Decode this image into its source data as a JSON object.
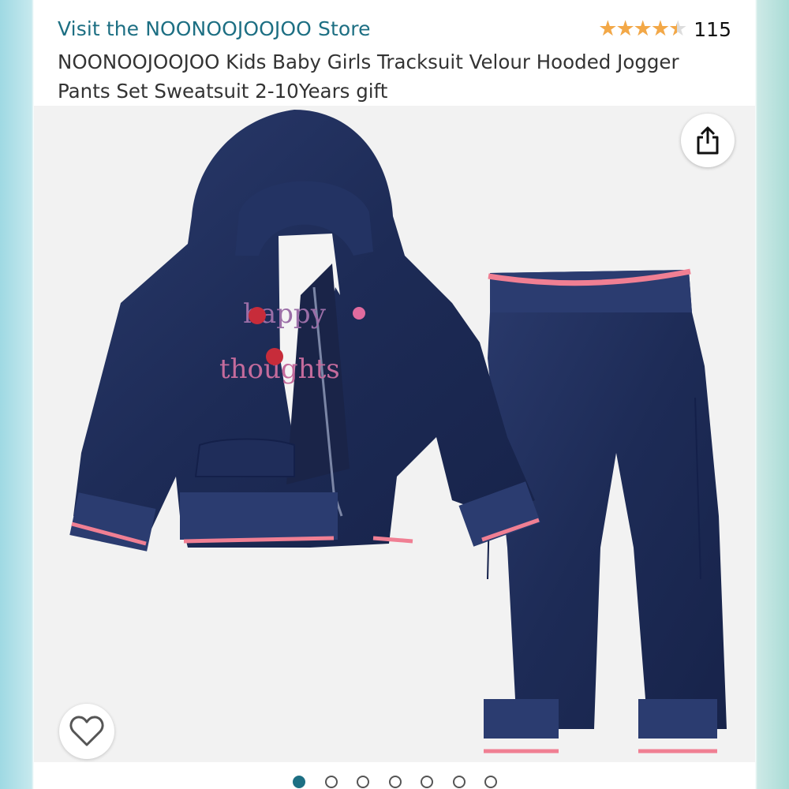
{
  "header": {
    "store_link": "Visit the NOONOOJOOJOO Store",
    "rating": {
      "value": 4.5,
      "max": 5,
      "stars": "★★★★★",
      "count": "115"
    },
    "title": "NOONOOJOOJOO Kids Baby Girls Tracksuit Velour Hooded Jogger Pants Set Sweatsuit 2-10Years gift"
  },
  "image": {
    "jacket_embroidery": [
      "happy",
      "thoughts"
    ],
    "share_icon": "share-icon",
    "wishlist_icon": "heart-outline-icon"
  },
  "carousel": {
    "total": 7,
    "active_index": 0
  },
  "colors": {
    "link": "#1d6f83",
    "star": "#f3a847",
    "garment": "#1d2b56",
    "trim": "#f07f93",
    "dot_active": "#1d6f83"
  }
}
